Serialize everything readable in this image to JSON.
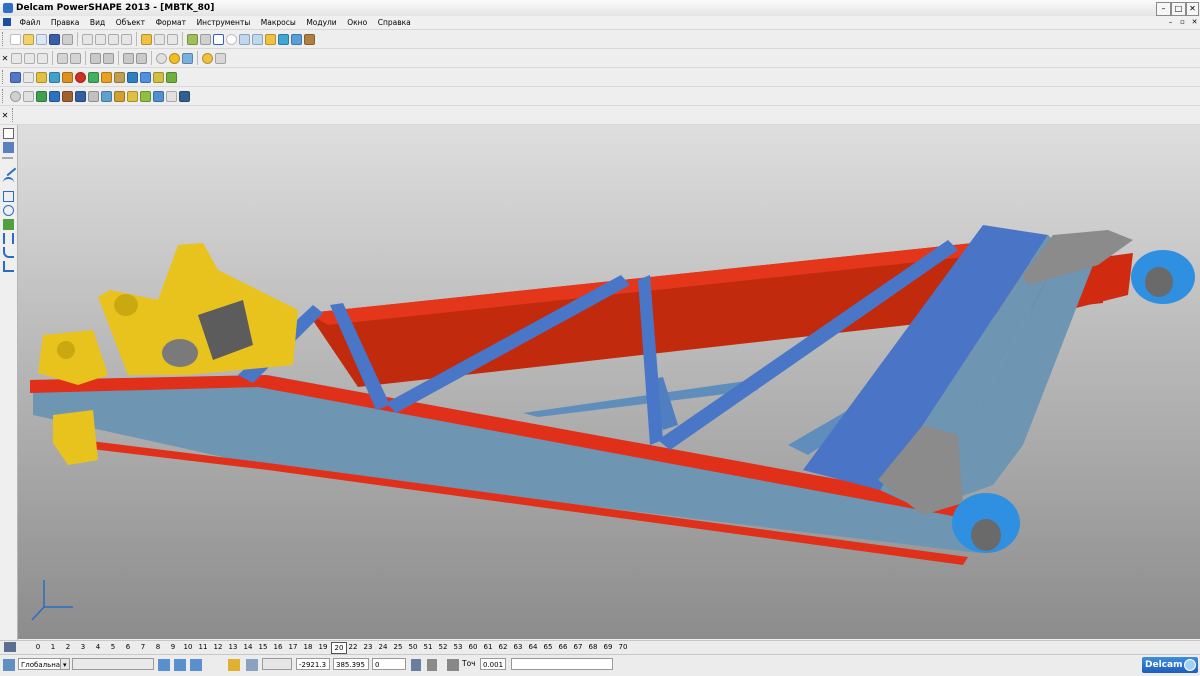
{
  "window": {
    "title": "Delcam PowerSHAPE 2013 - [MBTK_80]"
  },
  "menu": {
    "items": [
      "Файл",
      "Правка",
      "Вид",
      "Объект",
      "Формат",
      "Инструменты",
      "Макросы",
      "Модули",
      "Окно",
      "Справка"
    ]
  },
  "levels": {
    "numbers": [
      "0",
      "1",
      "2",
      "3",
      "4",
      "5",
      "6",
      "7",
      "8",
      "9",
      "10",
      "11",
      "12",
      "13",
      "14",
      "15",
      "16",
      "17",
      "18",
      "19",
      "20",
      "22",
      "23",
      "24",
      "25",
      "50",
      "51",
      "52",
      "53",
      "60",
      "61",
      "62",
      "63",
      "64",
      "65",
      "66",
      "67",
      "68",
      "69",
      "70"
    ],
    "selected": "20"
  },
  "status": {
    "workplane": "Глобальна",
    "coord_x": "-2921.3",
    "coord_y": "385.395",
    "coord_z": "0",
    "tolerance_label": "Точ",
    "tolerance_value": "0.001",
    "brand": "Delcam"
  },
  "colors": {
    "red": "#e02b10",
    "blue_gray": "#6d93b0",
    "panel_blue": "#4a76c8",
    "yellow": "#e9c31d",
    "cap_blue": "#2f8fe0",
    "gray": "#8a8a8a"
  },
  "icons": [
    "app-icon",
    "minimize-icon",
    "maximize-icon",
    "close-icon",
    "select-arrow-icon",
    "line-icon",
    "arc-icon",
    "rectangle-icon",
    "circle-icon",
    "solid-icon",
    "dimension-icon",
    "surface-icon",
    "axis-triad-icon"
  ]
}
